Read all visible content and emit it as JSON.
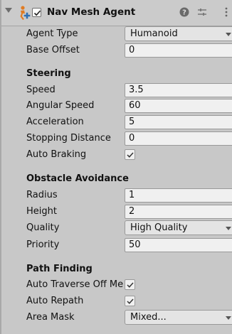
{
  "component": {
    "title": "Nav Mesh Agent",
    "enabled": true,
    "icons": [
      "foldout-arrow-icon",
      "navmesh-agent-icon",
      "help-icon",
      "preset-icon",
      "more-options-icon"
    ]
  },
  "fields": {
    "agent_type": {
      "label": "Agent Type",
      "value": "Humanoid"
    },
    "base_offset": {
      "label": "Base Offset",
      "value": "0"
    }
  },
  "steering": {
    "heading": "Steering",
    "speed": {
      "label": "Speed",
      "value": "3.5"
    },
    "angular_speed": {
      "label": "Angular Speed",
      "value": "60"
    },
    "acceleration": {
      "label": "Acceleration",
      "value": "5"
    },
    "stopping_distance": {
      "label": "Stopping Distance",
      "value": "0"
    },
    "auto_braking": {
      "label": "Auto Braking",
      "checked": true
    }
  },
  "obstacle_avoidance": {
    "heading": "Obstacle Avoidance",
    "radius": {
      "label": "Radius",
      "value": "1"
    },
    "height": {
      "label": "Height",
      "value": "2"
    },
    "quality": {
      "label": "Quality",
      "value": "High Quality"
    },
    "priority": {
      "label": "Priority",
      "value": "50"
    }
  },
  "path_finding": {
    "heading": "Path Finding",
    "auto_traverse": {
      "label": "Auto Traverse Off Me",
      "checked": true
    },
    "auto_repath": {
      "label": "Auto Repath",
      "checked": true
    },
    "area_mask": {
      "label": "Area Mask",
      "value": "Mixed..."
    }
  },
  "colors": {
    "background": "#c8c8c8",
    "field": "#f0f0f0",
    "dropdown": "#e4e4e4",
    "icon_blue": "#2f6fb3",
    "icon_orange": "#e07b22"
  }
}
